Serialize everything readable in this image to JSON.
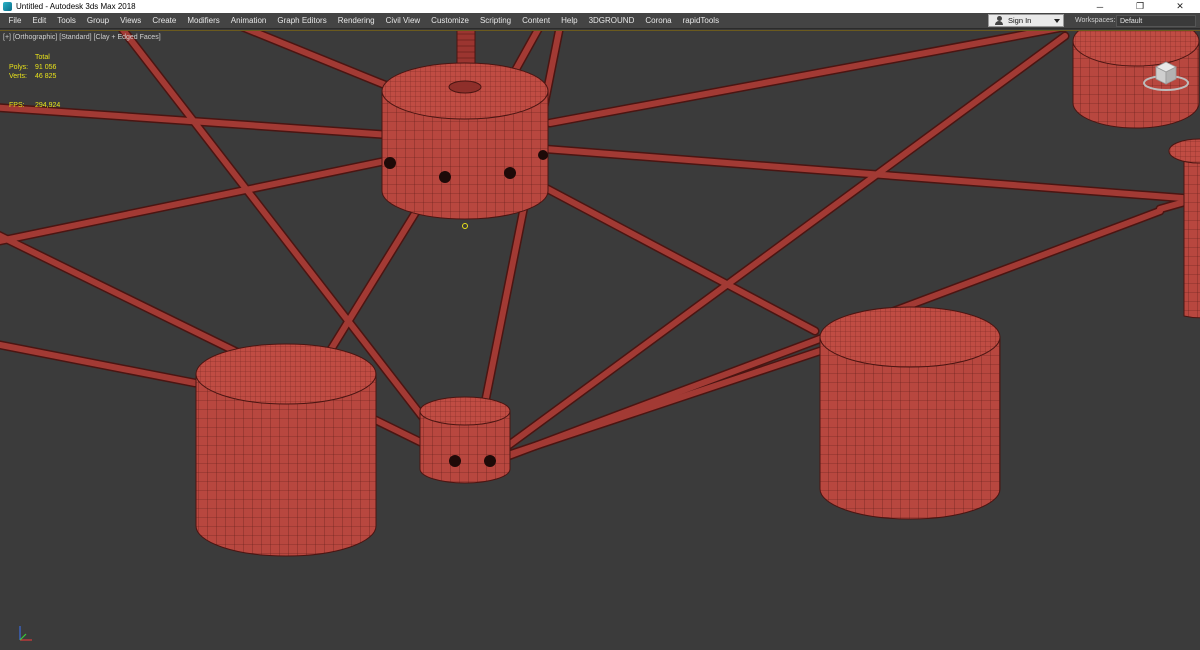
{
  "window": {
    "title": "Untitled - Autodesk 3ds Max 2018",
    "controls": {
      "minimize": "─",
      "restore": "❐",
      "close": "✕"
    }
  },
  "menubar": {
    "items": [
      "File",
      "Edit",
      "Tools",
      "Group",
      "Views",
      "Create",
      "Modifiers",
      "Animation",
      "Graph Editors",
      "Rendering",
      "Civil View",
      "Customize",
      "Scripting",
      "Content",
      "Help",
      "3DGROUND",
      "Corona",
      "rapidTools"
    ],
    "sign_in": "Sign In",
    "workspaces_label": "Workspaces:",
    "workspaces_value": "Default"
  },
  "viewport": {
    "label_parts": [
      "[+]",
      "[Orthographic]",
      "[Standard]",
      "[Clay + Edged Faces]"
    ],
    "stats": {
      "total_label": "Total",
      "polys_label": "Polys:",
      "polys_value": "91 056",
      "verts_label": "Verts:",
      "verts_value": "46 825",
      "fps_label": "FPS:",
      "fps_value": "294,924"
    }
  },
  "colors": {
    "viewport_bg": "#3b3b3b",
    "mesh_fill": "#b8473f",
    "mesh_edges": "#5a1a16",
    "stats_text": "#e9e31a",
    "menubar_bg": "#444444"
  },
  "icons": {
    "app": "3dsmax-app-icon",
    "viewcube": "viewcube-icon",
    "axis": "axis-tripod-icon",
    "sign_in": "user-icon"
  }
}
